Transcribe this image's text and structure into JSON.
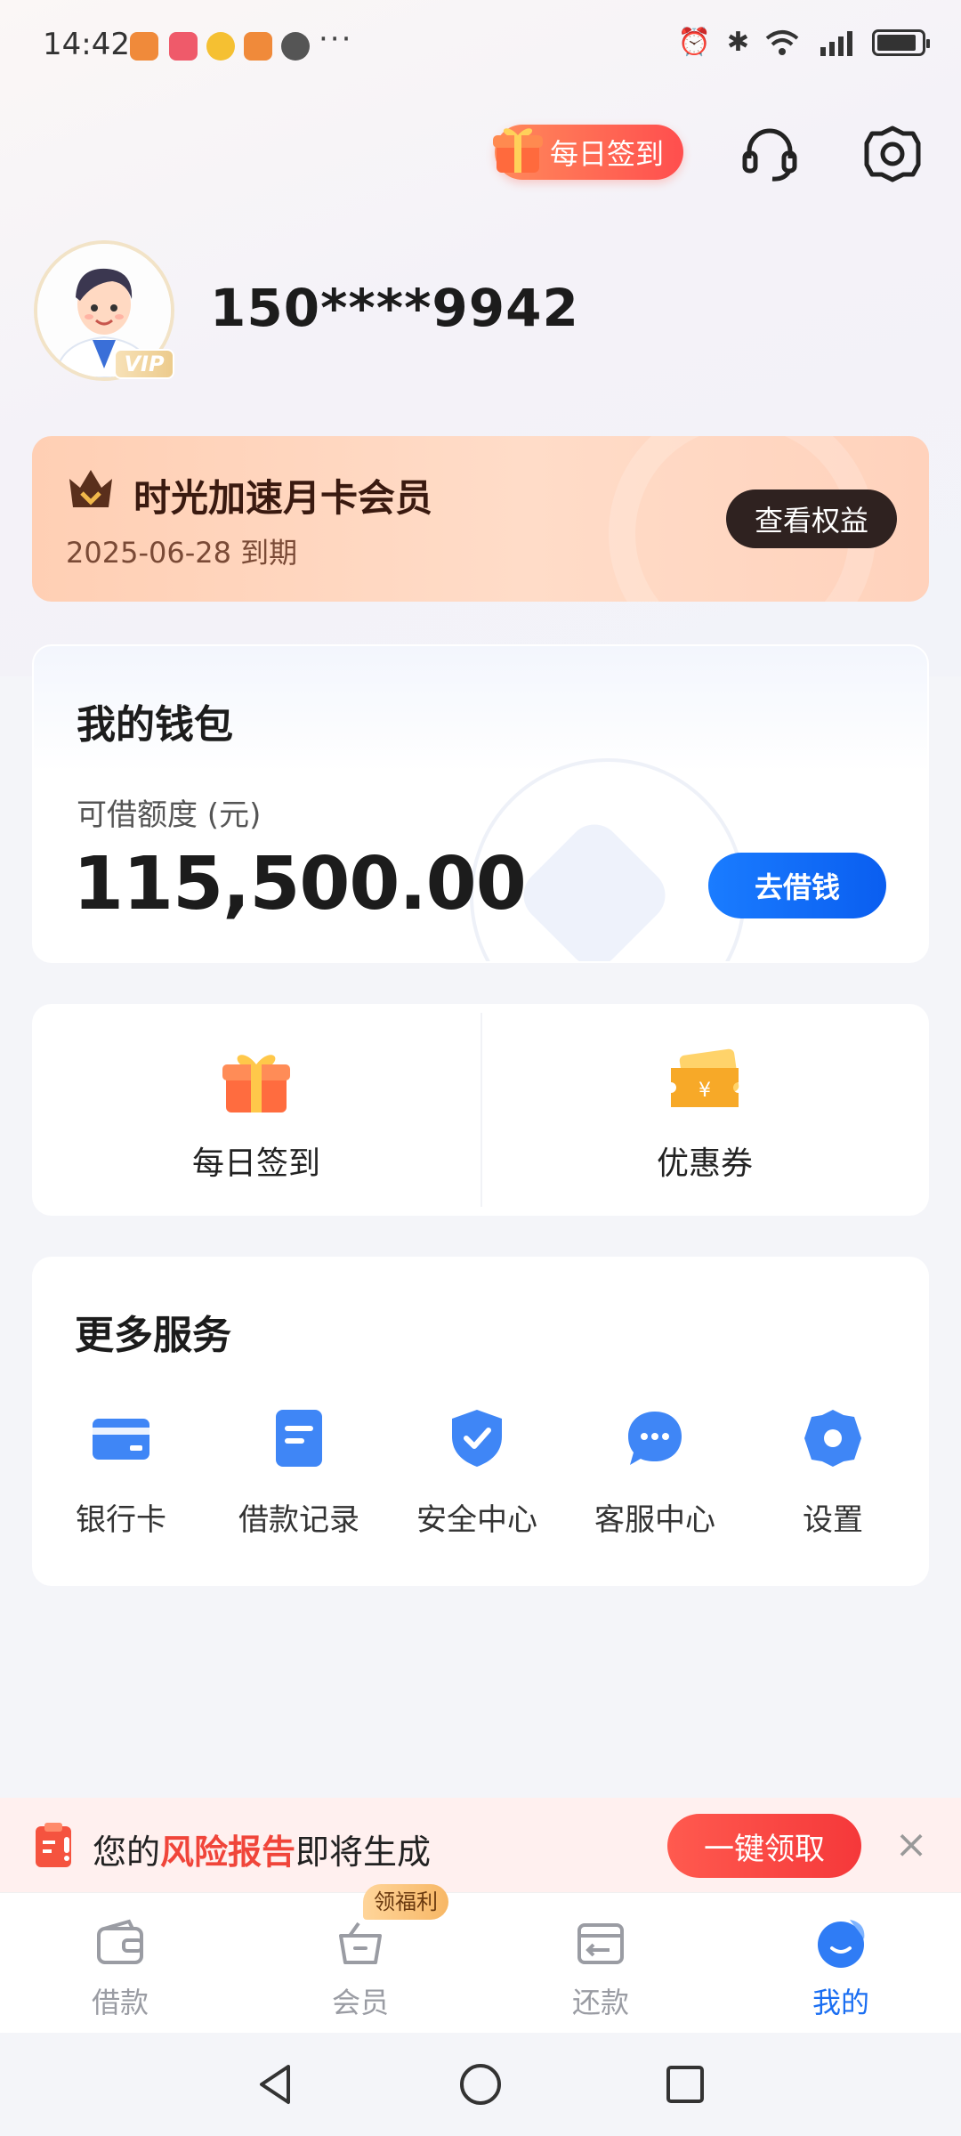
{
  "status_bar": {
    "time": "14:42",
    "more": "···"
  },
  "header": {
    "checkin_label": "每日签到",
    "icons": [
      "headset-icon",
      "settings-gear-icon"
    ]
  },
  "profile": {
    "phone": "150****9942",
    "vip_tag": "VIP"
  },
  "member_card": {
    "title": "时光加速月卡会员",
    "expiry": "2025-06-28 到期",
    "button": "查看权益"
  },
  "wallet": {
    "title": "我的钱包",
    "credit_label": "可借额度 (元)",
    "credit_amount": "115,500.00",
    "borrow_button": "去借钱"
  },
  "quick_actions": [
    {
      "label": "每日签到",
      "icon": "gift-icon"
    },
    {
      "label": "优惠券",
      "icon": "coupon-icon"
    }
  ],
  "services": {
    "title": "更多服务",
    "items": [
      {
        "label": "银行卡",
        "icon": "bank-card-icon"
      },
      {
        "label": "借款记录",
        "icon": "document-icon"
      },
      {
        "label": "安全中心",
        "icon": "shield-icon"
      },
      {
        "label": "客服中心",
        "icon": "chat-bubble-icon"
      },
      {
        "label": "设置",
        "icon": "gear-icon"
      }
    ]
  },
  "risk_banner": {
    "prefix": "您的",
    "highlight": "风险报告",
    "suffix": "即将生成",
    "button": "一键领取",
    "close": "×"
  },
  "bottom_nav": {
    "items": [
      {
        "label": "借款",
        "icon": "wallet-icon",
        "active": false
      },
      {
        "label": "会员",
        "icon": "basket-icon",
        "active": false,
        "badge": "领福利"
      },
      {
        "label": "还款",
        "icon": "repay-icon",
        "active": false
      },
      {
        "label": "我的",
        "icon": "profile-icon",
        "active": true
      }
    ]
  },
  "colors": {
    "primary": "#1a6ef2",
    "accent_red": "#f0453a",
    "member_bg": "#ffd2bc"
  }
}
